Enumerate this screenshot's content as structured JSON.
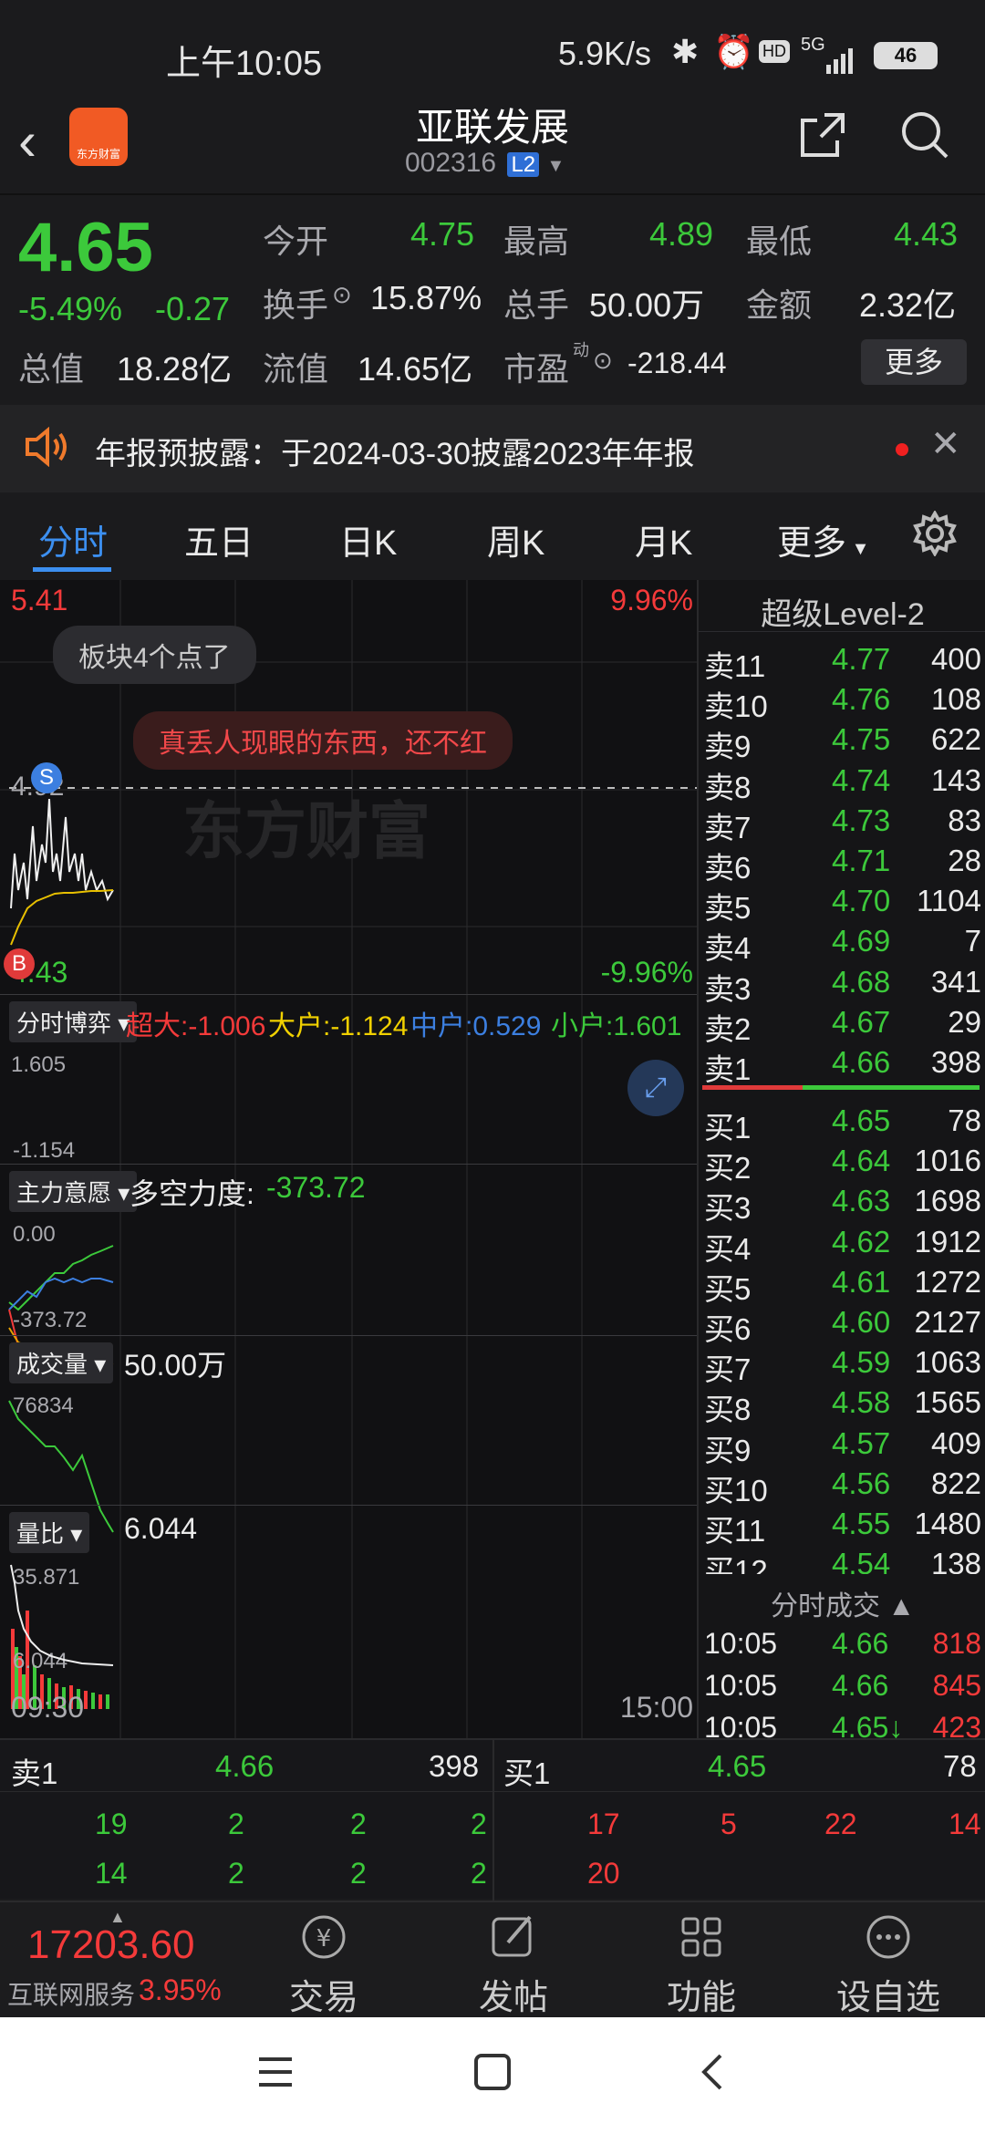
{
  "status_bar": {
    "time": "上午10:05",
    "net_speed": "5.9K/s",
    "battery": "46",
    "signal": "5G"
  },
  "header": {
    "title": "亚联发展",
    "code": "002316",
    "level_badge": "L2",
    "logo_text": "东方财富"
  },
  "quote": {
    "price": "4.65",
    "change_pct": "-5.49%",
    "change": "-0.27",
    "open_label": "今开",
    "open": "4.75",
    "high_label": "最高",
    "high": "4.89",
    "low_label": "最低",
    "low": "4.43",
    "turnover_label": "换手",
    "turnover": "15.87%",
    "volume_label": "总手",
    "volume": "50.00万",
    "amount_label": "金额",
    "amount": "2.32亿",
    "mktcap_label": "总值",
    "mktcap": "18.28亿",
    "float_label": "流值",
    "float": "14.65亿",
    "pe_label": "市盈",
    "pe_sup": "动",
    "pe": "-218.44",
    "more": "更多"
  },
  "notice": {
    "text": "年报预披露：于2024-03-30披露2023年年报"
  },
  "tabs": [
    "分时",
    "五日",
    "日K",
    "周K",
    "月K",
    "更多"
  ],
  "chart": {
    "top_price": "5.41",
    "top_pct": "9.96%",
    "bottom_price": "4.43",
    "bottom_pct": "-9.96%",
    "mid_price": "4.92",
    "bubble1": "板块4个点了",
    "bubble2": "真丢人现眼的东西，还不红",
    "watermark": "东方财富",
    "marker_s": "S",
    "marker_b": "B",
    "flow_label": "分时博弈",
    "flow_super": "超大:-1.006",
    "flow_big": "大户:-1.124",
    "flow_mid": "中户:0.529",
    "flow_small": "小户:1.601",
    "flow_top": "1.605",
    "flow_bottom": "-1.154",
    "force_label": "主力意愿",
    "force_text": "多空力度:",
    "force_value": "-373.72",
    "force_top": "0.00",
    "force_bottom": "-373.72",
    "vol_label": "成交量",
    "vol_value": "50.00万",
    "vol_top": "76834",
    "ratio_label": "量比",
    "ratio_value": "6.044",
    "ratio_top": "35.871",
    "ratio_bottom": "6.044",
    "time_start": "09:30",
    "time_end": "15:00"
  },
  "book": {
    "title": "超级Level-2",
    "asks": [
      {
        "label": "卖11",
        "price": "4.77",
        "vol": "400"
      },
      {
        "label": "卖10",
        "price": "4.76",
        "vol": "108"
      },
      {
        "label": "卖9",
        "price": "4.75",
        "vol": "622"
      },
      {
        "label": "卖8",
        "price": "4.74",
        "vol": "143"
      },
      {
        "label": "卖7",
        "price": "4.73",
        "vol": "83"
      },
      {
        "label": "卖6",
        "price": "4.71",
        "vol": "28"
      },
      {
        "label": "卖5",
        "price": "4.70",
        "vol": "1104"
      },
      {
        "label": "卖4",
        "price": "4.69",
        "vol": "7"
      },
      {
        "label": "卖3",
        "price": "4.68",
        "vol": "341"
      },
      {
        "label": "卖2",
        "price": "4.67",
        "vol": "29"
      },
      {
        "label": "卖1",
        "price": "4.66",
        "vol": "398"
      }
    ],
    "bids": [
      {
        "label": "买1",
        "price": "4.65",
        "vol": "78"
      },
      {
        "label": "买2",
        "price": "4.64",
        "vol": "1016"
      },
      {
        "label": "买3",
        "price": "4.63",
        "vol": "1698"
      },
      {
        "label": "买4",
        "price": "4.62",
        "vol": "1912"
      },
      {
        "label": "买5",
        "price": "4.61",
        "vol": "1272"
      },
      {
        "label": "买6",
        "price": "4.60",
        "vol": "2127"
      },
      {
        "label": "买7",
        "price": "4.59",
        "vol": "1063"
      },
      {
        "label": "买8",
        "price": "4.58",
        "vol": "1565"
      },
      {
        "label": "买9",
        "price": "4.57",
        "vol": "409"
      },
      {
        "label": "买10",
        "price": "4.56",
        "vol": "822"
      },
      {
        "label": "买11",
        "price": "4.55",
        "vol": "1480"
      },
      {
        "label": "买12",
        "price": "4.54",
        "vol": "138"
      }
    ],
    "ticks_title": "分时成交",
    "ticks": [
      {
        "time": "10:05",
        "price": "4.66",
        "vol": "818"
      },
      {
        "time": "10:05",
        "price": "4.66",
        "vol": "845"
      },
      {
        "time": "10:05",
        "price": "4.65↓",
        "vol": "423"
      }
    ]
  },
  "bottom_quote": {
    "sell_label": "卖1",
    "sell_price": "4.66",
    "sell_vol": "398",
    "buy_label": "买1",
    "buy_price": "4.65",
    "buy_vol": "78",
    "sell_queue": [
      "19",
      "2",
      "2",
      "2",
      "14",
      "2",
      "2",
      "2"
    ],
    "buy_queue": [
      "17",
      "5",
      "22",
      "14",
      "20"
    ]
  },
  "toolbar": {
    "index_value": "17203.60",
    "index_name": "互联网服务",
    "index_pct": "3.95%",
    "trade": "交易",
    "post": "发帖",
    "func": "功能",
    "watch": "设自选"
  }
}
